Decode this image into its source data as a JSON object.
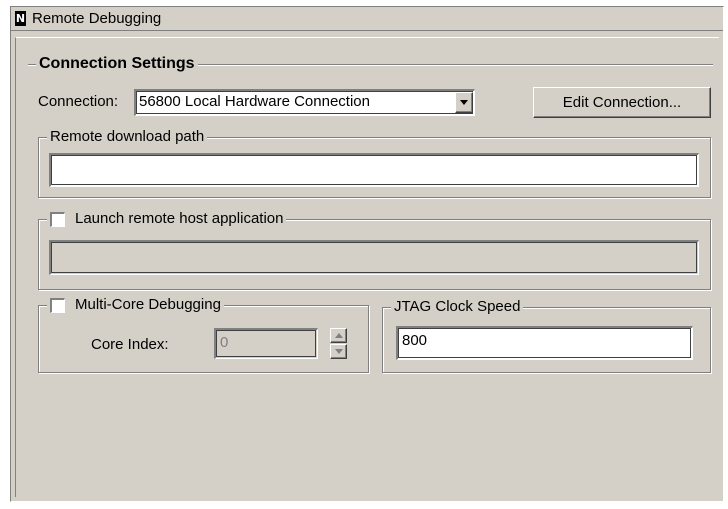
{
  "window": {
    "title": "Remote Debugging",
    "icon": "app-logo-icon"
  },
  "connection_settings": {
    "group_label": "Connection Settings",
    "connection_label": "Connection:",
    "connection_value": "56800 Local Hardware Connection",
    "edit_button_label": "Edit Connection..."
  },
  "remote_download": {
    "group_label": "Remote download path",
    "value": ""
  },
  "launch_remote": {
    "checkbox_label": "Launch remote host application",
    "checked": false,
    "value": ""
  },
  "multicore": {
    "checkbox_label": "Multi-Core Debugging",
    "checked": false,
    "core_index_label": "Core Index:",
    "core_index_value": "0"
  },
  "jtag": {
    "group_label": "JTAG Clock Speed",
    "value": "800"
  },
  "colors": {
    "panel_bg": "#d4d0c8",
    "shadow": "#808080",
    "highlight": "#ffffff"
  }
}
